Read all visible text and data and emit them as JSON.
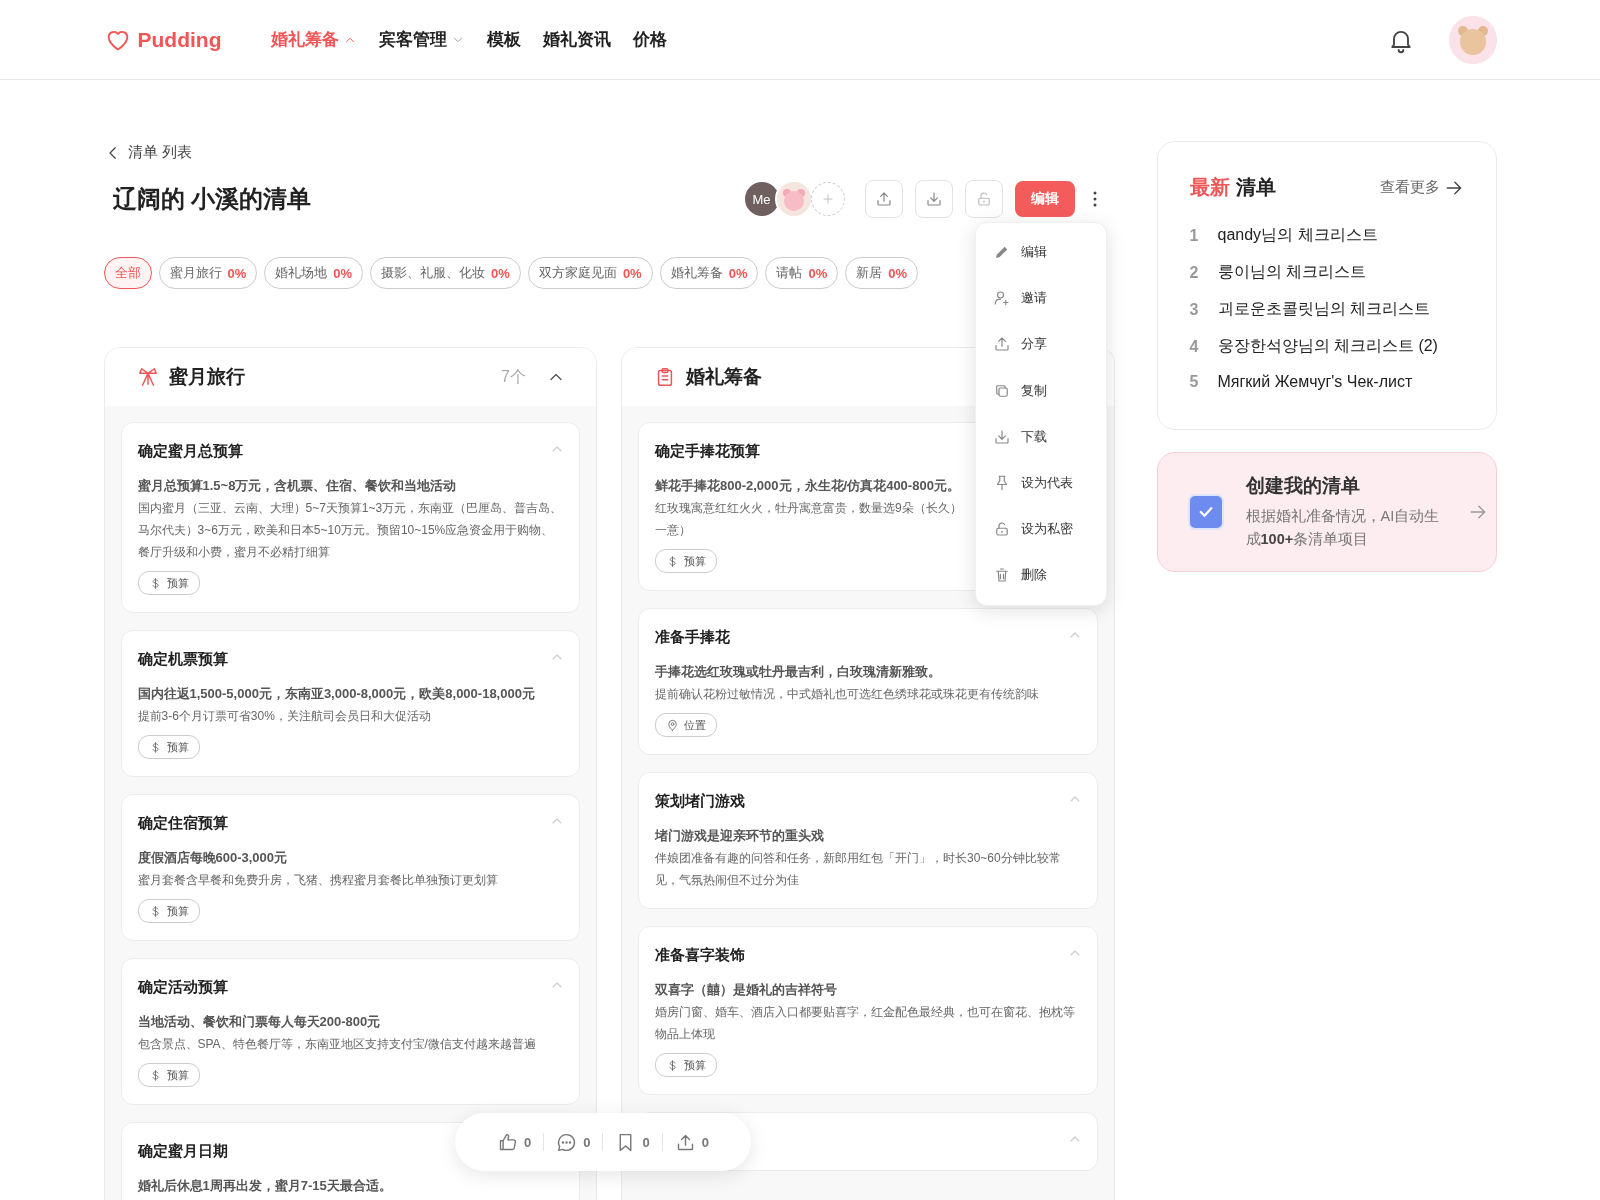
{
  "header": {
    "logo": "Pudding",
    "nav": [
      {
        "label": "婚礼筹备",
        "selected": true,
        "expanded": true
      },
      {
        "label": "宾客管理",
        "selected": false,
        "expanded": false
      },
      {
        "label": "模板",
        "selected": false
      },
      {
        "label": "婚礼资讯",
        "selected": false
      },
      {
        "label": "价格",
        "selected": false
      }
    ]
  },
  "breadcrumb": "清单 列表",
  "title": "辽阔的 小溪的清单",
  "collaborators": [
    {
      "kind": "initials",
      "label": "Me"
    },
    {
      "kind": "picture"
    }
  ],
  "edit_button": "编辑",
  "filters": [
    {
      "label": "全部",
      "selected": true
    },
    {
      "label": "蜜月旅行",
      "percent": "0%",
      "selected": false
    },
    {
      "label": "婚礼场地",
      "percent": "0%",
      "selected": false
    },
    {
      "label": "摄影、礼服、化妆",
      "percent": "0%",
      "selected": false
    },
    {
      "label": "双方家庭见面",
      "percent": "0%",
      "selected": false
    },
    {
      "label": "婚礼筹备",
      "percent": "0%",
      "selected": false
    },
    {
      "label": "请帖",
      "percent": "0%",
      "selected": false
    },
    {
      "label": "新居",
      "percent": "0%",
      "selected": false
    }
  ],
  "columns": [
    {
      "title": "蜜月旅行",
      "count": "7个",
      "expanded": true,
      "cards": [
        {
          "title": "确定蜜月总预算",
          "expanded": true,
          "summary": "蜜月总预算1.5~8万元，含机票、住宿、餐饮和当地活动",
          "desc": [
            "国内蜜月（三亚、云南、大理）5~7天预算1~3万元，东南亚（巴厘岛、普吉岛、马尔代夫）3~6万元，欧美和日本5~10万元。预留10~15%应急资金用于购物、餐厅升级和小费，蜜月不必精打细算"
          ],
          "tag": {
            "kind": "budget",
            "label": "预算"
          }
        },
        {
          "title": "确定机票预算",
          "expanded": true,
          "summary": "国内往返1,500-5,000元，东南亚3,000-8,000元，欧美8,000-18,000元",
          "desc": [
            "提前3-6个月订票可省30%，关注航司会员日和大促活动"
          ],
          "tag": {
            "kind": "budget",
            "label": "预算"
          }
        },
        {
          "title": "确定住宿预算",
          "expanded": true,
          "summary": "度假酒店每晚600-3,000元",
          "desc": [
            "蜜月套餐含早餐和免费升房，飞猪、携程蜜月套餐比单独预订更划算"
          ],
          "tag": {
            "kind": "budget",
            "label": "预算"
          }
        },
        {
          "title": "确定活动预算",
          "expanded": true,
          "summary": "当地活动、餐饮和门票每人每天200-800元",
          "desc": [
            "包含景点、SPA、特色餐厅等，东南亚地区支持支付宝/微信支付越来越普遍"
          ],
          "tag": {
            "kind": "budget",
            "label": "预算"
          }
        },
        {
          "title": "确定蜜月日期",
          "summary": "婚礼后休息1周再出发，蜜月7-15天最合适。"
        }
      ]
    },
    {
      "title": "婚礼筹备",
      "cards": [
        {
          "title": "确定手捧花预算",
          "summary": "鲜花手捧花800-2,000元，永生花/仿真花400-800元。",
          "desc": [
            "红玫瑰寓意红红火火，牡丹寓意富贵，数量选9朵（长久）",
            "一意）"
          ],
          "tag": {
            "kind": "budget",
            "label": "预算"
          }
        },
        {
          "title": "准备手捧花",
          "expanded": true,
          "summary": "手捧花选红玫瑰或牡丹最吉利，白玫瑰清新雅致。",
          "desc": [
            "提前确认花粉过敏情况，中式婚礼也可选红色绣球花或珠花更有传统韵味"
          ],
          "tag": {
            "kind": "location",
            "label": "位置"
          }
        },
        {
          "title": "策划堵门游戏",
          "expanded": true,
          "summary": "堵门游戏是迎亲环节的重头戏",
          "desc": [
            "伴娘团准备有趣的问答和任务，新郎用红包「开门」，时长30~60分钟比较常见，气氛热闹但不过分为佳"
          ]
        },
        {
          "title": "准备喜字装饰",
          "expanded": true,
          "summary": "双喜字（囍）是婚礼的吉祥符号",
          "desc": [
            "婚房门窗、婚车、酒店入口都要贴喜字，红金配色最经典，也可在窗花、抱枕等物品上体现"
          ],
          "tag": {
            "kind": "budget",
            "label": "预算"
          }
        },
        {
          "expanded": true
        }
      ]
    }
  ],
  "menu": [
    {
      "label": "编辑"
    },
    {
      "label": "邀请"
    },
    {
      "label": "分享"
    },
    {
      "label": "复制"
    },
    {
      "label": "下载"
    },
    {
      "label": "设为代表"
    },
    {
      "label": "设为私密"
    },
    {
      "label": "删除"
    }
  ],
  "reactions": [
    {
      "count": "0"
    },
    {
      "count": "0"
    },
    {
      "count": "0"
    },
    {
      "count": "0"
    }
  ],
  "latest": {
    "title_accent": "最新",
    "title": "清单",
    "more": "查看更多",
    "items": [
      {
        "rank": "1",
        "name": "qandy님의 체크리스트"
      },
      {
        "rank": "2",
        "name": "룽이님의 체크리스트"
      },
      {
        "rank": "3",
        "name": "괴로운초콜릿님의 체크리스트"
      },
      {
        "rank": "4",
        "name": "웅장한석양님의 체크리스트 (2)"
      },
      {
        "rank": "5",
        "name": "Мягкий Жемчуг's Чек-лист"
      }
    ]
  },
  "promo": {
    "title": "创建我的清单",
    "text": "根据婚礼准备情况，AI自动生成**100+**条清单项目",
    "checked": true
  }
}
